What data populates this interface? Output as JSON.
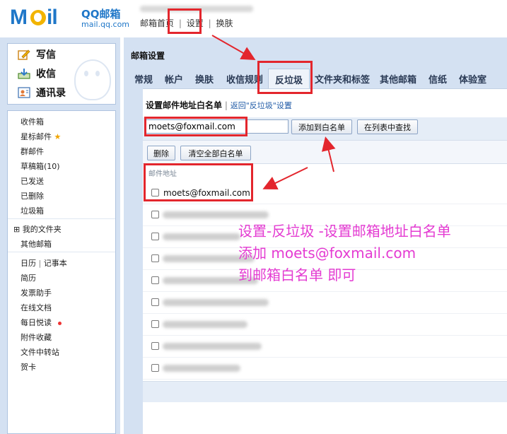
{
  "header": {
    "logo_name": "QQ邮箱",
    "logo_url": "mail.qq.com",
    "nav": [
      "邮箱首页",
      "设置",
      "换肤"
    ]
  },
  "sidebar": {
    "actions": [
      {
        "label": "写信",
        "icon": "compose-icon"
      },
      {
        "label": "收信",
        "icon": "inbox-download-icon"
      },
      {
        "label": "通讯录",
        "icon": "contacts-icon"
      }
    ],
    "folders": [
      "收件箱",
      "星标邮件",
      "群邮件",
      "草稿箱(10)",
      "已发送",
      "已删除",
      "垃圾箱"
    ],
    "my_folders": "我的文件夹",
    "other_mail": "其他邮箱",
    "tools": {
      "calendar": "日历",
      "notes": "记事本",
      "items": [
        "简历",
        "发票助手",
        "在线文档",
        "每日悦读",
        "附件收藏",
        "文件中转站",
        "贺卡"
      ]
    }
  },
  "main": {
    "title": "邮箱设置",
    "tabs": [
      "常规",
      "帐户",
      "换肤",
      "收信规则",
      "反垃圾",
      "文件夹和标签",
      "其他邮箱",
      "信纸",
      "体验室"
    ],
    "active_tab": "反垃圾",
    "whitelist": {
      "heading": "设置邮件地址白名单",
      "back_link": "返回\"反垃圾\"设置",
      "input_value": "moets@foxmail.com",
      "add_button": "添加到白名单",
      "find_button": "在列表中查找",
      "delete_button": "删除",
      "clear_button": "清空全部白名单",
      "column_header": "邮件地址",
      "entries": [
        "moets@foxmail.com"
      ]
    }
  },
  "annotation": {
    "lines": [
      "设置-反垃圾 -设置邮箱地址白名单",
      "添加 moets@foxmail.com",
      "到邮箱白名单 即可"
    ],
    "color": "#e43bd2",
    "highlight_color": "#e3262d"
  },
  "colors": {
    "brand_blue": "#1f77c8",
    "panel_bg": "#d4e1f2",
    "link": "#1f5aa6"
  }
}
